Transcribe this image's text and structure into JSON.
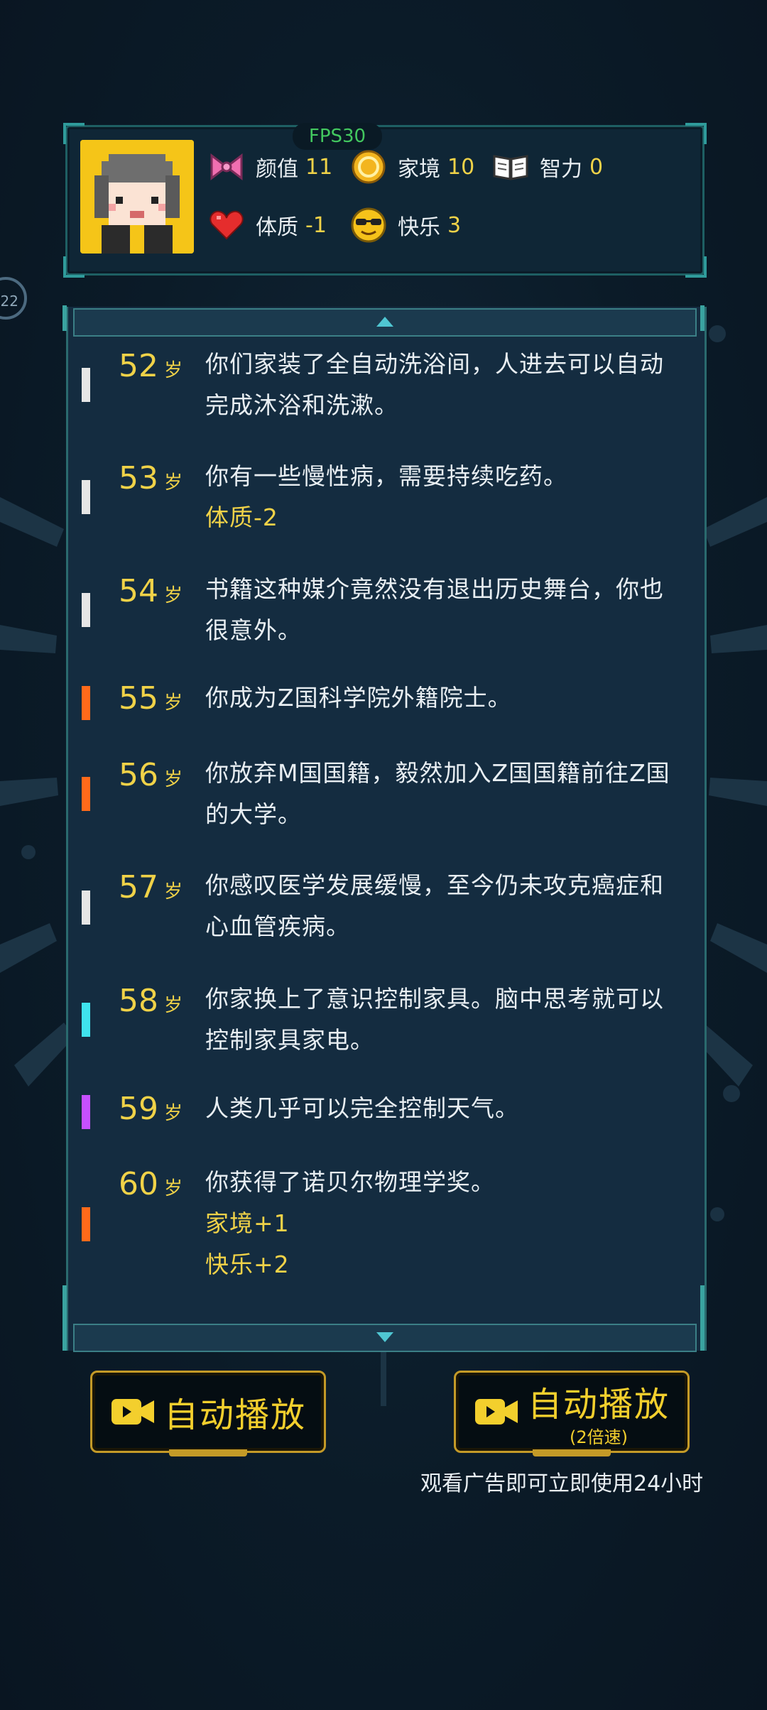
{
  "hud": {
    "fps": "FPS30",
    "stats": [
      {
        "name": "颜值",
        "value": "11",
        "icon": "bow-icon"
      },
      {
        "name": "家境",
        "value": "10",
        "icon": "coin-icon"
      },
      {
        "name": "智力",
        "value": "0",
        "icon": "book-icon"
      },
      {
        "name": "体质",
        "value": "-1",
        "icon": "heart-icon"
      },
      {
        "name": "快乐",
        "value": "3",
        "icon": "sunglasses-face-icon"
      }
    ]
  },
  "side_badge": "22",
  "events": [
    {
      "age": "52",
      "unit": "岁",
      "tag_color": "#e6e6e6",
      "text": "你们家装了全自动洗浴间，人进去可以自动完成沐浴和洗漱。",
      "effects": []
    },
    {
      "age": "53",
      "unit": "岁",
      "tag_color": "#e6e6e6",
      "text": "你有一些慢性病，需要持续吃药。",
      "effects": [
        "体质-2"
      ]
    },
    {
      "age": "54",
      "unit": "岁",
      "tag_color": "#e6e6e6",
      "text": "书籍这种媒介竟然没有退出历史舞台，你也很意外。",
      "effects": []
    },
    {
      "age": "55",
      "unit": "岁",
      "tag_color": "#ff6a1a",
      "text": "你成为Z国科学院外籍院士。",
      "effects": []
    },
    {
      "age": "56",
      "unit": "岁",
      "tag_color": "#ff6a1a",
      "text": "你放弃M国国籍，毅然加入Z国国籍前往Z国的大学。",
      "effects": []
    },
    {
      "age": "57",
      "unit": "岁",
      "tag_color": "#e6e6e6",
      "text": "你感叹医学发展缓慢，至今仍未攻克癌症和心血管疾病。",
      "effects": []
    },
    {
      "age": "58",
      "unit": "岁",
      "tag_color": "#3fe3ee",
      "text": "你家换上了意识控制家具。脑中思考就可以控制家具家电。",
      "effects": []
    },
    {
      "age": "59",
      "unit": "岁",
      "tag_color": "#c650ff",
      "text": "人类几乎可以完全控制天气。",
      "effects": []
    },
    {
      "age": "60",
      "unit": "岁",
      "tag_color": "#ff6a1a",
      "text": "你获得了诺贝尔物理学奖。",
      "effects": [
        "家境+1",
        "快乐+2"
      ]
    }
  ],
  "buttons": {
    "autoplay": "自动播放",
    "autoplay_fast": "自动播放",
    "autoplay_fast_sub": "(2倍速)",
    "ad_note": "观看广告即可立即使用24小时"
  }
}
